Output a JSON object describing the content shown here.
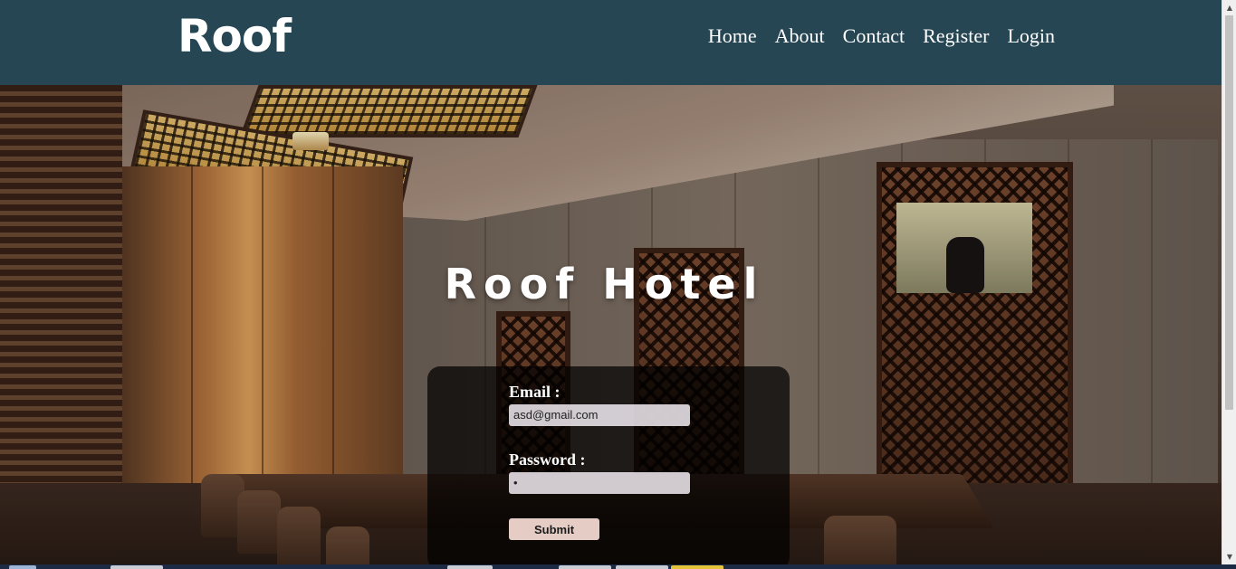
{
  "header": {
    "logo": "Roof",
    "nav": [
      {
        "label": "Home"
      },
      {
        "label": "About"
      },
      {
        "label": "Contact"
      },
      {
        "label": "Register"
      },
      {
        "label": "Login"
      }
    ]
  },
  "hero": {
    "title": "Roof Hotel"
  },
  "login_form": {
    "email_label": "Email :",
    "email_value": "asd@gmail.com",
    "password_label": "Password :",
    "password_value": "•",
    "submit_label": "Submit"
  },
  "scrollbar": {
    "up_icon": "triangle-up-icon",
    "down_icon": "triangle-down-icon"
  },
  "colors": {
    "header_bg": "#264653",
    "form_bg": "rgba(0,0,0,0.72)",
    "submit_bg": "#e5cdc6"
  }
}
